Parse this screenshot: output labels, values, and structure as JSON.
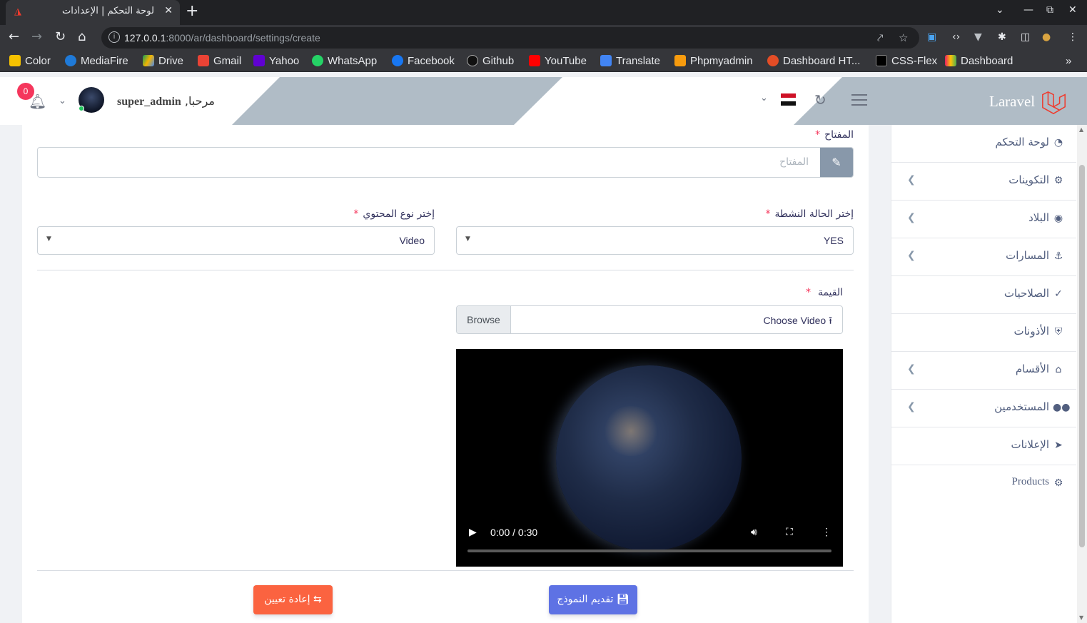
{
  "browser": {
    "tab_title": "لوحة التحكم | الإعدادات",
    "url_host": "127.0.0.1",
    "url_rest": ":8000/ar/dashboard/settings/create",
    "bookmarks": [
      "Color",
      "MediaFire",
      "Drive",
      "Gmail",
      "Yahoo",
      "WhatsApp",
      "Facebook",
      "Github",
      "YouTube",
      "Translate",
      "Phpmyadmin",
      "Dashboard HT...",
      "CSS-Flex",
      "Dashboard"
    ]
  },
  "header": {
    "brand": "Laravel",
    "greeting": "مرحبا,",
    "username": "super_admin",
    "notification_count": "0"
  },
  "sidebar": {
    "items": [
      {
        "label": "لوحة التحكم",
        "icon": "dashboard-icon",
        "has_chevron": false
      },
      {
        "label": "التكوينات",
        "icon": "cogs-icon",
        "has_chevron": true
      },
      {
        "label": "البلاد",
        "icon": "globe-icon",
        "has_chevron": true
      },
      {
        "label": "المسارات",
        "icon": "anchor-icon",
        "has_chevron": true
      },
      {
        "label": "الصلاحيات",
        "icon": "check-icon",
        "has_chevron": false
      },
      {
        "label": "الأذونات",
        "icon": "shield-icon",
        "has_chevron": false
      },
      {
        "label": "الأقسام",
        "icon": "home-icon",
        "has_chevron": true
      },
      {
        "label": "المستخدمين",
        "icon": "users-icon",
        "has_chevron": true
      },
      {
        "label": "الإعلانات",
        "icon": "bullhorn-icon",
        "has_chevron": false
      },
      {
        "label": "Products",
        "icon": "cogs-icon",
        "has_chevron": false
      }
    ]
  },
  "form": {
    "key_label": "المفتاح",
    "key_placeholder": "المفتاح",
    "active_label": "إختر الحالة النشطة",
    "active_value": "YES",
    "content_type_label": "إختر نوع المحتوي",
    "content_type_value": "Video",
    "value_label": "القيمة",
    "file_label": "Choose Video",
    "browse_label": "Browse",
    "video_time": "0:00 / 0:30",
    "submit_label": "تقديم النموذج",
    "reset_label": "إعادة تعيين"
  },
  "colors": {
    "primary": "#5e72e4",
    "warning": "#fb6340",
    "danger": "#f5365c",
    "header_deco": "#b0bcc6",
    "laravel_red": "#ef3b2d"
  }
}
